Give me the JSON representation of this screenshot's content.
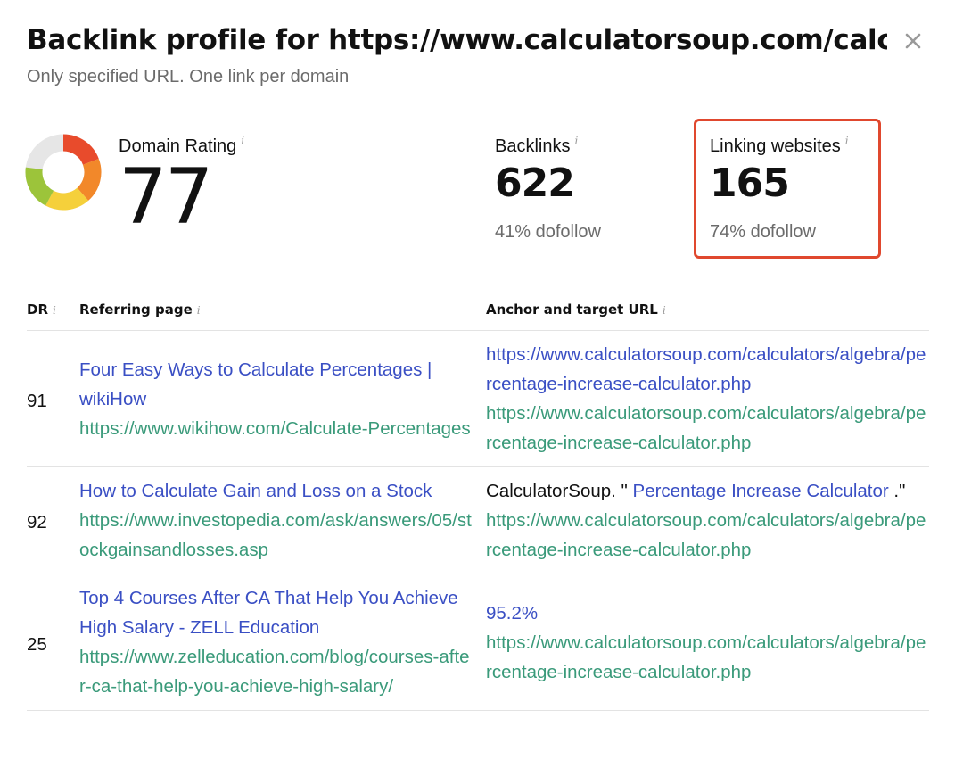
{
  "header": {
    "title": "Backlink profile for https://www.calculatorsoup.com/calc…",
    "subtitle": "Only specified URL. One link per domain"
  },
  "metrics": {
    "domain_rating": {
      "label": "Domain Rating",
      "value": "77",
      "gauge_fraction": 0.77,
      "gauge_colors": [
        "#f5d03b",
        "#9cc43a",
        "#e84b2c",
        "#f2882a"
      ]
    },
    "backlinks": {
      "label": "Backlinks",
      "value": "622",
      "sub": "41% dofollow"
    },
    "linking_websites": {
      "label": "Linking websites",
      "value": "165",
      "sub": "74% dofollow"
    },
    "info_glyph": "i",
    "highlight_color": "#e0482e"
  },
  "table": {
    "headers": {
      "dr": "DR",
      "referring_page": "Referring page",
      "anchor": "Anchor and target URL"
    },
    "rows": [
      {
        "dr": "91",
        "ref_title": "Four Easy Ways to Calculate Percentages | wikiHow",
        "ref_url": "https://www.wikihow.com/Calculate-Percentages",
        "anchor_prefix": "",
        "anchor_link": "https://www.calculatorsoup.com/calculators/algebra/percentage-increase-calculator.php",
        "anchor_suffix": "",
        "target_url": "https://www.calculatorsoup.com/calculators/algebra/percentage-increase-calculator.php"
      },
      {
        "dr": "92",
        "ref_title": "How to Calculate Gain and Loss on a Stock",
        "ref_url": "https://www.investopedia.com/ask/answers/05/stockgainsandlosses.asp",
        "anchor_prefix": "CalculatorSoup. \" ",
        "anchor_link": "Percentage Increase Calculator",
        "anchor_suffix": " .\"",
        "target_url": "https://www.calculatorsoup.com/calculators/algebra/percentage-increase-calculator.php"
      },
      {
        "dr": "25",
        "ref_title": "Top 4 Courses After CA That Help You Achieve High Salary - ZELL Education",
        "ref_url": "https://www.zelleducation.com/blog/courses-after-ca-that-help-you-achieve-high-salary/",
        "anchor_prefix": "",
        "anchor_link": "95.2%",
        "anchor_suffix": "",
        "target_url": "https://www.calculatorsoup.com/calculators/algebra/percentage-increase-calculator.php"
      }
    ]
  }
}
